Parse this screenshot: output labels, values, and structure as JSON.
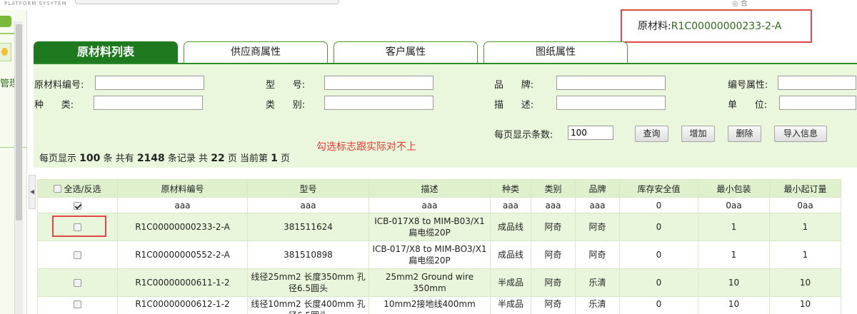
{
  "header": {
    "logo_text": "PLATFORM SYSYTEM",
    "right_icon": "◎ 合"
  },
  "sidebar": {
    "label": "管理"
  },
  "material": {
    "label": "原材料:",
    "value": "R1C00000000233-2-A"
  },
  "tabs": [
    {
      "label": "原材料列表",
      "active": true
    },
    {
      "label": "供应商属性",
      "active": false
    },
    {
      "label": "客户属性",
      "active": false
    },
    {
      "label": "图纸属性",
      "active": false
    }
  ],
  "form": {
    "code_label": "原材料编号:",
    "model_label": "型      号:",
    "brand_label": "品      牌:",
    "attr_label": "编号属性:",
    "kind_label": "种      类:",
    "category_label": "类      别:",
    "desc_label": "描      述:",
    "unit_label": "单      位:",
    "page_size_label": "每页显示条数:",
    "page_size_value": "100",
    "code_value": "",
    "model_value": "",
    "brand_value": "",
    "attr_value": "",
    "kind_value": "",
    "category_value": "",
    "desc_value": "",
    "unit_value": ""
  },
  "buttons": {
    "query": "查询",
    "add": "增加",
    "delete": "删除",
    "import": "导入信息"
  },
  "note": "勾选标志跟实际对不上",
  "summary": {
    "prefix": "每页显示",
    "per_page": "100",
    "unit1": "条  共有",
    "total": "2148",
    "unit2": "条记录  共",
    "pages": "22",
    "unit3": "页  当前第",
    "current": "1",
    "unit4": "页"
  },
  "table": {
    "select_all_label": "全选/反选",
    "columns": [
      "原材料编号",
      "型号",
      "描述",
      "种类",
      "类别",
      "品牌",
      "库存安全值",
      "最小包装",
      "最小起订量"
    ],
    "filter_row": [
      "aaa",
      "aaa",
      "aaa",
      "aaa",
      "aaa",
      "aaa",
      "0",
      "0aa",
      "0aa"
    ],
    "rows": [
      [
        "R1C00000000233-2-A",
        "381511624",
        "ICB-017X8 to MIM-B03/X1扁电缆20P",
        "成品线",
        "阿奇",
        "阿奇",
        "0",
        "1",
        "1"
      ],
      [
        "R1C00000000552-2-A",
        "381510898",
        "ICB-017/X8 to MIM-BO3/X1扁电缆20P",
        "成品线",
        "阿奇",
        "阿奇",
        "0",
        "1",
        "1"
      ],
      [
        "R1C00000000611-1-2",
        "线径25mm2 长度350mm 孔径6.5圆头",
        "25mm2 Ground wire 350mm",
        "半成品",
        "阿奇",
        "乐清",
        "0",
        "10",
        "10"
      ],
      [
        "R1C00000000612-1-2",
        "线径10mm2 长度400mm 孔径6.5圆头",
        "10mm2接地线400mm",
        "半成品",
        "阿奇",
        "乐清",
        "0",
        "10",
        "10"
      ]
    ]
  }
}
